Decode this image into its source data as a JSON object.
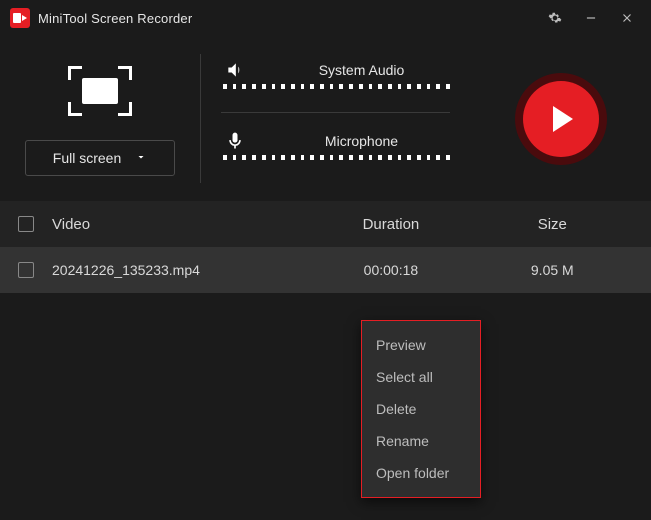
{
  "app": {
    "title": "MiniTool Screen Recorder"
  },
  "capture": {
    "mode_label": "Full screen"
  },
  "audio": {
    "system_label": "System Audio",
    "mic_label": "Microphone"
  },
  "table": {
    "headers": {
      "video": "Video",
      "duration": "Duration",
      "size": "Size"
    },
    "rows": [
      {
        "name": "20241226_135233.mp4",
        "duration": "00:00:18",
        "size": "9.05 M"
      }
    ]
  },
  "context_menu": {
    "items": {
      "preview": "Preview",
      "select_all": "Select all",
      "delete": "Delete",
      "rename": "Rename",
      "open_folder": "Open folder"
    }
  }
}
